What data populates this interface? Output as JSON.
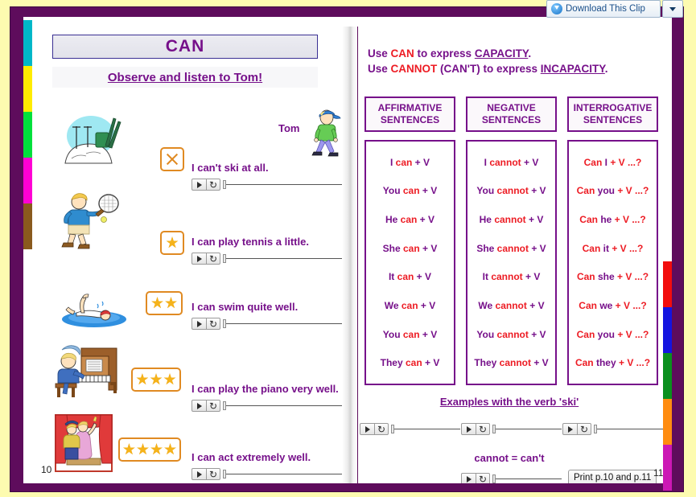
{
  "overlay": {
    "download_label": "Download This Clip",
    "download_icon": "download-heart-icon",
    "caret_icon": "chevron-down-icon"
  },
  "colors": {
    "frame": "#5e0c5c",
    "heading_purple": "#76108a",
    "accent_red": "#ed1c24",
    "star_gold": "#f5b31a",
    "box_orange": "#e08a22",
    "page_bg": "#fdfbb0"
  },
  "tabs": {
    "left": [
      "#00b7c8",
      "#ffec00",
      "#00e03c",
      "#ff00d4",
      "#8a5a1e"
    ],
    "right": [
      "#f20d0d",
      "#1414e0",
      "#0a8f1e",
      "#ff8c10",
      "#cc18b5"
    ]
  },
  "left_page": {
    "title": "CAN",
    "subtitle": "Observe and listen to Tom!",
    "character_label": "Tom",
    "character_icon": "walking-boy-icon",
    "page_number": "10",
    "rows": [
      {
        "illustration": "skiing-snow-icon",
        "rating": 0,
        "rating_mark": "x-mark-icon",
        "sentence": "I can't ski at all."
      },
      {
        "illustration": "tennis-player-icon",
        "rating": 1,
        "rating_mark": "star-icon",
        "sentence": "I can play tennis a little."
      },
      {
        "illustration": "swimmer-icon",
        "rating": 2,
        "rating_mark": "star-icon",
        "sentence": "I can swim quite well."
      },
      {
        "illustration": "piano-player-icon",
        "rating": 3,
        "rating_mark": "star-icon",
        "sentence": "I can play the piano very well."
      },
      {
        "illustration": "theatre-stage-icon",
        "rating": 4,
        "rating_mark": "star-icon",
        "sentence": "I can act extremely well."
      }
    ]
  },
  "right_page": {
    "intro": [
      {
        "prefix": "Use ",
        "keyword": "CAN",
        "middle": " to express ",
        "target": "CAPACITY",
        "suffix": "."
      },
      {
        "prefix": "Use ",
        "keyword": "CANNOT",
        "middle": " (CAN'T) to express ",
        "target": "INCAPACITY",
        "suffix": "."
      }
    ],
    "column_headers": [
      {
        "line1": "AFFIRMATIVE",
        "line2": "SENTENCES"
      },
      {
        "line1": "NEGATIVE",
        "line2": "SENTENCES"
      },
      {
        "line1": "INTERROGATIVE",
        "line2": "SENTENCES"
      }
    ],
    "columns": [
      {
        "name": "affirmative",
        "cells": [
          {
            "subject": "I",
            "modal": "can",
            "rest": " + V"
          },
          {
            "subject": "You",
            "modal": "can",
            "rest": " + V"
          },
          {
            "subject": "He",
            "modal": "can",
            "rest": " + V"
          },
          {
            "subject": "She",
            "modal": "can",
            "rest": " + V"
          },
          {
            "subject": "It",
            "modal": "can",
            "rest": " + V"
          },
          {
            "subject": "We",
            "modal": "can",
            "rest": " + V"
          },
          {
            "subject": "You",
            "modal": "can",
            "rest": " + V"
          },
          {
            "subject": "They",
            "modal": "can",
            "rest": " + V"
          }
        ]
      },
      {
        "name": "negative",
        "cells": [
          {
            "subject": "I",
            "modal": "cannot",
            "rest": " + V"
          },
          {
            "subject": "You",
            "modal": "cannot",
            "rest": " + V"
          },
          {
            "subject": "He",
            "modal": "cannot",
            "rest": " + V"
          },
          {
            "subject": "She",
            "modal": "cannot",
            "rest": " + V"
          },
          {
            "subject": "It",
            "modal": "cannot",
            "rest": " + V"
          },
          {
            "subject": "We",
            "modal": "cannot",
            "rest": " + V"
          },
          {
            "subject": "You",
            "modal": "cannot",
            "rest": " + V"
          },
          {
            "subject": "They",
            "modal": "cannot",
            "rest": " + V"
          }
        ]
      },
      {
        "name": "interrogative",
        "cells": [
          {
            "modal": "Can",
            "subject": "I",
            "rest": " + V ...?"
          },
          {
            "modal": "Can",
            "subject": "you",
            "rest": " + V ...?"
          },
          {
            "modal": "Can",
            "subject": "he",
            "rest": " + V ...?"
          },
          {
            "modal": "Can",
            "subject": "it",
            "rest": " + V ...?"
          },
          {
            "modal": "Can",
            "subject": "she",
            "rest": " + V ...?"
          },
          {
            "modal": "Can",
            "subject": "we",
            "rest": " + V ...?"
          },
          {
            "modal": "Can",
            "subject": "you",
            "rest": " + V ...?"
          },
          {
            "modal": "Can",
            "subject": "they",
            "rest": " + V ...?"
          }
        ]
      }
    ],
    "examples_title": "Examples with the verb 'ski'",
    "cannot_equals": "cannot = can't",
    "print_label": "Print p.10 and p.11",
    "page_number": "11"
  },
  "player": {
    "play_icon": "play-icon",
    "replay_icon": "replay-icon",
    "slider_icon": "progress-slider"
  }
}
